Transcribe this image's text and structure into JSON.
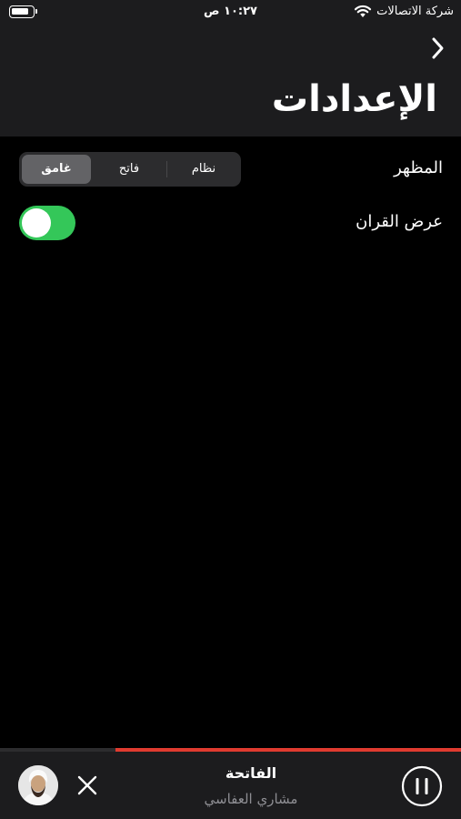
{
  "status_bar": {
    "carrier": "شركة الاتصالات",
    "time": "١٠:٢٧ ص",
    "battery_level": 0.85
  },
  "header": {
    "back_icon": "chevron-right-icon",
    "title": "الإعدادات"
  },
  "settings": {
    "appearance": {
      "label": "المظهر",
      "options": [
        "نظام",
        "فاتح",
        "غامق"
      ],
      "selected": "غامق"
    },
    "show_quran": {
      "label": "عرض القران",
      "enabled": true
    }
  },
  "player": {
    "title": "الفاتحة",
    "artist": "مشاري العفاسي",
    "progress": 0.75,
    "close_icon": "close-icon",
    "pause_icon": "pause-icon"
  },
  "colors": {
    "background": "#000000",
    "header_bg": "#1c1c1e",
    "toggle_on": "#34c759",
    "progress": "#e03b2f",
    "secondary_text": "#8e8e93"
  }
}
